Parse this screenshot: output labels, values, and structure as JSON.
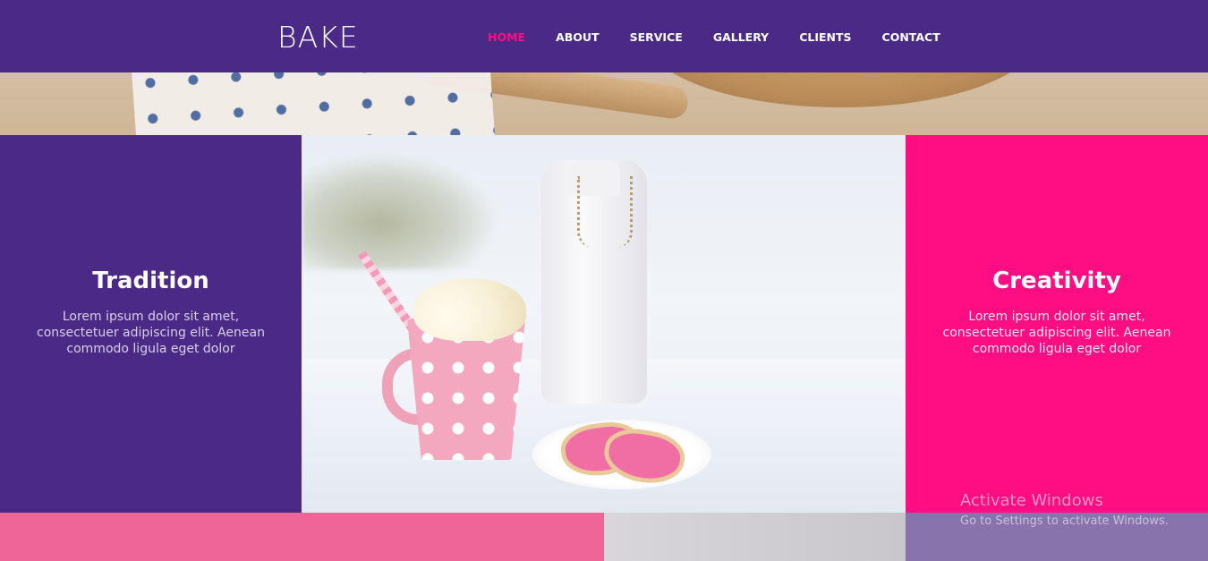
{
  "brand": "BAKE",
  "nav": {
    "items": [
      {
        "label": "HOME",
        "active": true
      },
      {
        "label": "ABOUT",
        "active": false
      },
      {
        "label": "SERVICE",
        "active": false
      },
      {
        "label": "GALLERY",
        "active": false
      },
      {
        "label": "CLIENTS",
        "active": false
      },
      {
        "label": "CONTACT",
        "active": false
      }
    ]
  },
  "features": {
    "left": {
      "title": "Tradition",
      "text": "Lorem ipsum dolor sit amet, consectetuer adipiscing elit. Aenean commodo ligula eget dolor"
    },
    "right": {
      "title": "Creativity",
      "text": "Lorem ipsum dolor sit amet, consectetuer adipiscing elit. Aenean commodo ligula eget dolor"
    }
  },
  "watermark": {
    "title": "Activate Windows",
    "subtitle": "Go to Settings to activate Windows."
  },
  "colors": {
    "purple": "#4a2a86",
    "pink": "#ff0d82",
    "nav_active": "#ff0d82",
    "strip_pink": "#ef6597",
    "strip_purple": "#8873ad"
  }
}
